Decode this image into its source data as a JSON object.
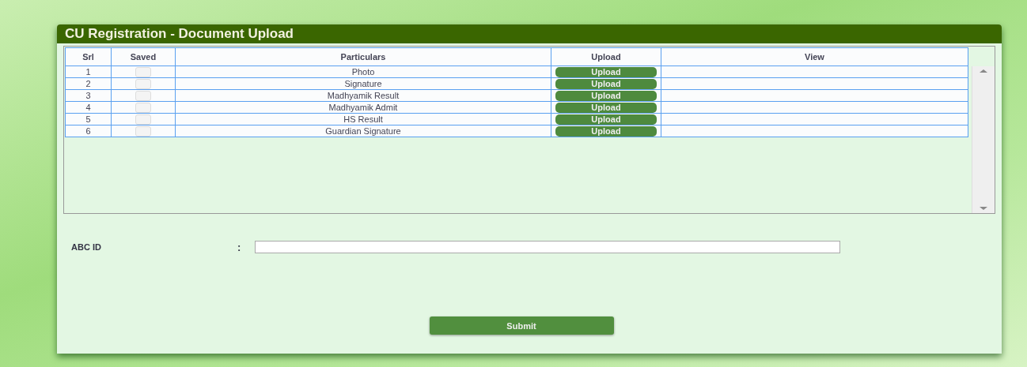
{
  "window": {
    "title": "CU Registration - Document Upload"
  },
  "table": {
    "columns": [
      "Srl",
      "Saved",
      "Particulars",
      "Upload",
      "View"
    ],
    "rows": [
      {
        "srl": "1",
        "checked": false,
        "particulars": "Photo",
        "upload": "Upload"
      },
      {
        "srl": "2",
        "checked": false,
        "particulars": "Signature",
        "upload": "Upload"
      },
      {
        "srl": "3",
        "checked": false,
        "particulars": "Madhyamik Result",
        "upload": "Upload"
      },
      {
        "srl": "4",
        "checked": false,
        "particulars": "Madhyamik Admit",
        "upload": "Upload"
      },
      {
        "srl": "5",
        "checked": false,
        "particulars": "HS Result",
        "upload": "Upload"
      },
      {
        "srl": "6",
        "checked": false,
        "particulars": "Guardian Signature",
        "upload": "Upload"
      }
    ]
  },
  "abc_id": {
    "label": "ABC ID",
    "separator": ":"
  },
  "submit": "Submit"
}
